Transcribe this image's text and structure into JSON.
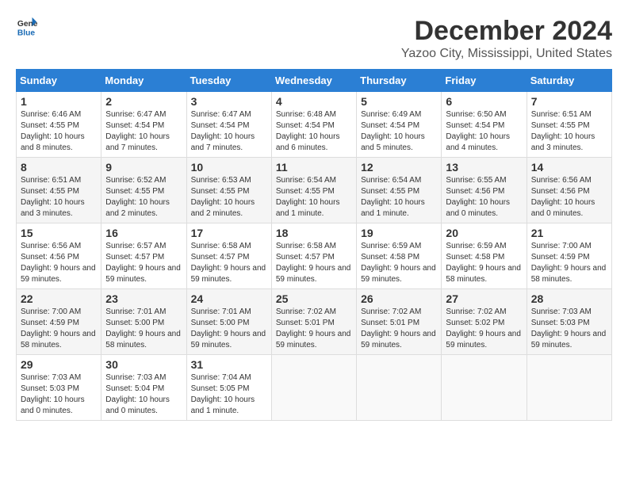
{
  "header": {
    "logo_line1": "General",
    "logo_line2": "Blue",
    "title": "December 2024",
    "subtitle": "Yazoo City, Mississippi, United States"
  },
  "days_of_week": [
    "Sunday",
    "Monday",
    "Tuesday",
    "Wednesday",
    "Thursday",
    "Friday",
    "Saturday"
  ],
  "weeks": [
    [
      {
        "day": "1",
        "sunrise": "6:46 AM",
        "sunset": "4:55 PM",
        "daylight": "10 hours and 8 minutes."
      },
      {
        "day": "2",
        "sunrise": "6:47 AM",
        "sunset": "4:54 PM",
        "daylight": "10 hours and 7 minutes."
      },
      {
        "day": "3",
        "sunrise": "6:47 AM",
        "sunset": "4:54 PM",
        "daylight": "10 hours and 7 minutes."
      },
      {
        "day": "4",
        "sunrise": "6:48 AM",
        "sunset": "4:54 PM",
        "daylight": "10 hours and 6 minutes."
      },
      {
        "day": "5",
        "sunrise": "6:49 AM",
        "sunset": "4:54 PM",
        "daylight": "10 hours and 5 minutes."
      },
      {
        "day": "6",
        "sunrise": "6:50 AM",
        "sunset": "4:54 PM",
        "daylight": "10 hours and 4 minutes."
      },
      {
        "day": "7",
        "sunrise": "6:51 AM",
        "sunset": "4:55 PM",
        "daylight": "10 hours and 3 minutes."
      }
    ],
    [
      {
        "day": "8",
        "sunrise": "6:51 AM",
        "sunset": "4:55 PM",
        "daylight": "10 hours and 3 minutes."
      },
      {
        "day": "9",
        "sunrise": "6:52 AM",
        "sunset": "4:55 PM",
        "daylight": "10 hours and 2 minutes."
      },
      {
        "day": "10",
        "sunrise": "6:53 AM",
        "sunset": "4:55 PM",
        "daylight": "10 hours and 2 minutes."
      },
      {
        "day": "11",
        "sunrise": "6:54 AM",
        "sunset": "4:55 PM",
        "daylight": "10 hours and 1 minute."
      },
      {
        "day": "12",
        "sunrise": "6:54 AM",
        "sunset": "4:55 PM",
        "daylight": "10 hours and 1 minute."
      },
      {
        "day": "13",
        "sunrise": "6:55 AM",
        "sunset": "4:56 PM",
        "daylight": "10 hours and 0 minutes."
      },
      {
        "day": "14",
        "sunrise": "6:56 AM",
        "sunset": "4:56 PM",
        "daylight": "10 hours and 0 minutes."
      }
    ],
    [
      {
        "day": "15",
        "sunrise": "6:56 AM",
        "sunset": "4:56 PM",
        "daylight": "9 hours and 59 minutes."
      },
      {
        "day": "16",
        "sunrise": "6:57 AM",
        "sunset": "4:57 PM",
        "daylight": "9 hours and 59 minutes."
      },
      {
        "day": "17",
        "sunrise": "6:58 AM",
        "sunset": "4:57 PM",
        "daylight": "9 hours and 59 minutes."
      },
      {
        "day": "18",
        "sunrise": "6:58 AM",
        "sunset": "4:57 PM",
        "daylight": "9 hours and 59 minutes."
      },
      {
        "day": "19",
        "sunrise": "6:59 AM",
        "sunset": "4:58 PM",
        "daylight": "9 hours and 59 minutes."
      },
      {
        "day": "20",
        "sunrise": "6:59 AM",
        "sunset": "4:58 PM",
        "daylight": "9 hours and 58 minutes."
      },
      {
        "day": "21",
        "sunrise": "7:00 AM",
        "sunset": "4:59 PM",
        "daylight": "9 hours and 58 minutes."
      }
    ],
    [
      {
        "day": "22",
        "sunrise": "7:00 AM",
        "sunset": "4:59 PM",
        "daylight": "9 hours and 58 minutes."
      },
      {
        "day": "23",
        "sunrise": "7:01 AM",
        "sunset": "5:00 PM",
        "daylight": "9 hours and 58 minutes."
      },
      {
        "day": "24",
        "sunrise": "7:01 AM",
        "sunset": "5:00 PM",
        "daylight": "9 hours and 59 minutes."
      },
      {
        "day": "25",
        "sunrise": "7:02 AM",
        "sunset": "5:01 PM",
        "daylight": "9 hours and 59 minutes."
      },
      {
        "day": "26",
        "sunrise": "7:02 AM",
        "sunset": "5:01 PM",
        "daylight": "9 hours and 59 minutes."
      },
      {
        "day": "27",
        "sunrise": "7:02 AM",
        "sunset": "5:02 PM",
        "daylight": "9 hours and 59 minutes."
      },
      {
        "day": "28",
        "sunrise": "7:03 AM",
        "sunset": "5:03 PM",
        "daylight": "9 hours and 59 minutes."
      }
    ],
    [
      {
        "day": "29",
        "sunrise": "7:03 AM",
        "sunset": "5:03 PM",
        "daylight": "10 hours and 0 minutes."
      },
      {
        "day": "30",
        "sunrise": "7:03 AM",
        "sunset": "5:04 PM",
        "daylight": "10 hours and 0 minutes."
      },
      {
        "day": "31",
        "sunrise": "7:04 AM",
        "sunset": "5:05 PM",
        "daylight": "10 hours and 1 minute."
      },
      null,
      null,
      null,
      null
    ]
  ]
}
